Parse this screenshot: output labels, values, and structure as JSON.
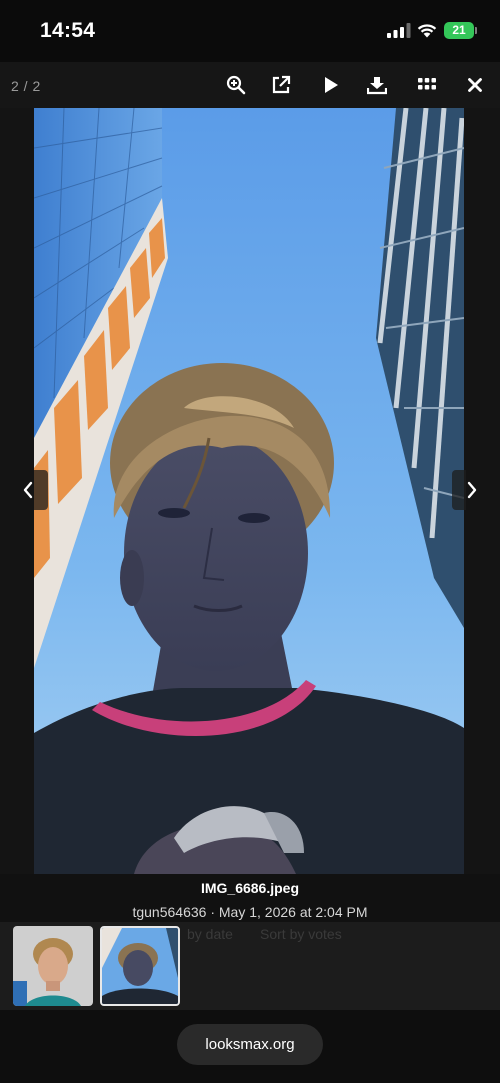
{
  "status_bar": {
    "time": "14:54",
    "battery": "21",
    "icons": [
      "cellular-signal-icon",
      "wifi-icon",
      "battery-charging-icon"
    ]
  },
  "toolbar": {
    "counter": "2 / 2",
    "icons": [
      "zoom-in-icon",
      "open-external-icon",
      "play-slideshow-icon",
      "download-icon",
      "grid-icon",
      "close-icon"
    ]
  },
  "photo": {
    "alt_description_icon": "photo",
    "sky_color": "#6aa8e6",
    "shirt_color": "#1f2733",
    "collar_color": "#c8407a"
  },
  "nav": {
    "prev_icon": "chevron-left-icon",
    "next_icon": "chevron-right-icon"
  },
  "caption": {
    "file_name": "IMG_6686.jpeg",
    "meta": "tgun564636 · May 1, 2026 at 2:04 PM"
  },
  "behind_links": {
    "sort_date": "by date",
    "sort_votes": "Sort by votes"
  },
  "thumbnails": {
    "selected_index": 2,
    "count": 2
  },
  "browser": {
    "url": "looksmax.org"
  },
  "colors": {
    "accent_battery": "#34c759",
    "background": "#141414"
  }
}
